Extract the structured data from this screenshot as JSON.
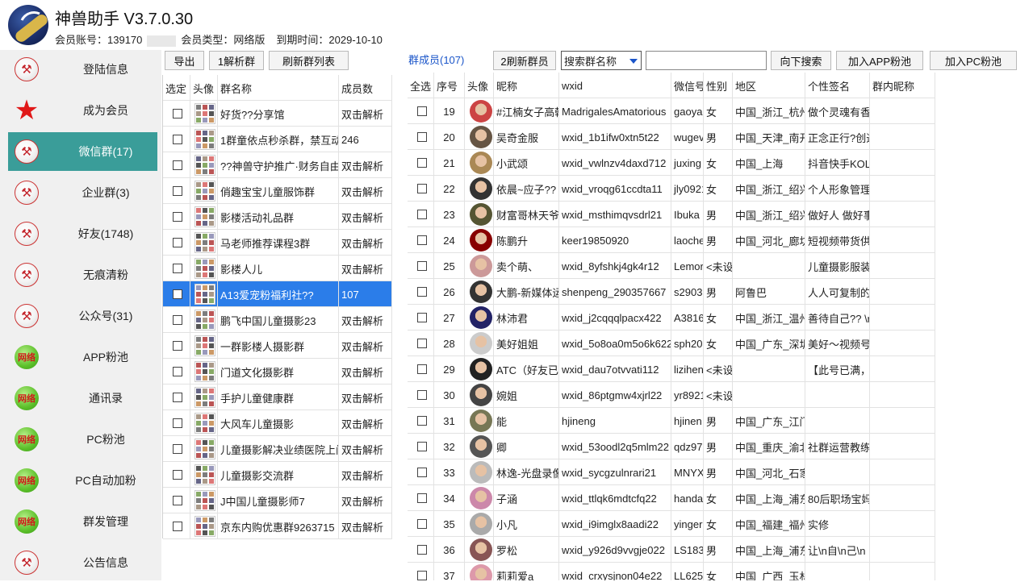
{
  "app": {
    "title": "神兽助手 V3.7.0.30",
    "account_label": "会员账号：139170",
    "member_type": "会员类型：网络版",
    "expire": "到期时间：2029-10-10"
  },
  "sidebar": {
    "items": [
      {
        "label": "登陆信息",
        "icon": "hammer-icon"
      },
      {
        "label": "成为会员",
        "icon": "star-icon"
      },
      {
        "label": "微信群(17)",
        "icon": "hammer-icon",
        "active": true
      },
      {
        "label": "企业群(3)",
        "icon": "hammer-icon"
      },
      {
        "label": "好友(1748)",
        "icon": "hammer-icon"
      },
      {
        "label": "无痕清粉",
        "icon": "hammer-icon"
      },
      {
        "label": "公众号(31)",
        "icon": "hammer-icon"
      },
      {
        "label": "APP粉池",
        "icon": "network-badge-icon"
      },
      {
        "label": "通讯录",
        "icon": "network-badge-icon"
      },
      {
        "label": "PC粉池",
        "icon": "network-badge-icon"
      },
      {
        "label": "PC自动加粉",
        "icon": "network-badge-icon"
      },
      {
        "label": "群发管理",
        "icon": "network-badge-icon"
      },
      {
        "label": "公告信息",
        "icon": "hammer-icon"
      }
    ],
    "badge_text": "网络"
  },
  "group_toolbar": {
    "export": "导出",
    "parse_one": "1解析群",
    "refresh_list": "刷新群列表"
  },
  "group_table": {
    "headers": [
      "选定",
      "头像",
      "群名称",
      "成员数"
    ],
    "rows": [
      {
        "name": "好货??分享馆",
        "count": "双击解析"
      },
      {
        "name": "1群童依点秒杀群，禁互动",
        "count": "246"
      },
      {
        "name": "??神兽守护推广·财务自由群",
        "count": "双击解析"
      },
      {
        "name": "俏趣宝宝儿童服饰群",
        "count": "双击解析"
      },
      {
        "name": "影楼活动礼品群",
        "count": "双击解析"
      },
      {
        "name": "马老师推荐课程3群",
        "count": "双击解析"
      },
      {
        "name": "影楼人儿",
        "count": "双击解析"
      },
      {
        "name": "A13爱宠粉福利社??",
        "count": "107",
        "selected": true
      },
      {
        "name": "鹏飞中国儿童摄影23",
        "count": "双击解析"
      },
      {
        "name": "一群影楼人摄影群",
        "count": "双击解析"
      },
      {
        "name": "门道文化摄影群",
        "count": "双击解析"
      },
      {
        "name": "手护儿童健康群",
        "count": "双击解析"
      },
      {
        "name": "大风车儿童摄影",
        "count": "双击解析"
      },
      {
        "name": "儿童摄影解决业绩医院上门",
        "count": "双击解析"
      },
      {
        "name": "儿童摄影交流群",
        "count": "双击解析"
      },
      {
        "name": "J中国儿童摄影师7",
        "count": "双击解析"
      },
      {
        "name": "京东内购优惠群9263715",
        "count": "双击解析"
      }
    ]
  },
  "member_toolbar": {
    "label": "群成员(107)",
    "refresh_members": "2刷新群员",
    "search_select": "搜索群名称",
    "search_down": "向下搜索",
    "add_app": "加入APP粉池",
    "add_pc": "加入PC粉池"
  },
  "member_table": {
    "headers": [
      "全选",
      "序号",
      "头像",
      "昵称",
      "wxid",
      "微信号",
      "性别",
      "地区",
      "个性签名",
      "群内昵称"
    ],
    "rows": [
      {
        "no": "19",
        "nick": "#江楠女子高韩",
        "wxid": "MadrigalesAmatorious",
        "wx": "gaoya",
        "sex": "女",
        "region": "中国_浙江_杭州",
        "sign": "做个灵魂有香"
      },
      {
        "no": "20",
        "nick": "吴奇金服",
        "wxid": "wxid_1b1ifw0xtn5t22",
        "wx": "wugev",
        "sex": "男",
        "region": "中国_天津_南开",
        "sign": "正念正行?创造"
      },
      {
        "no": "21",
        "nick": "小武颂",
        "wxid": "wxid_vwlnzv4daxd712",
        "wx": "juxing",
        "sex": "女",
        "region": "中国_上海",
        "sign": "抖音快手KOL"
      },
      {
        "no": "22",
        "nick": "依晨~应子??",
        "wxid": "wxid_vroqg61ccdta11",
        "wx": "jly0921",
        "sex": "女",
        "region": "中国_浙江_绍兴",
        "sign": "个人形象管理"
      },
      {
        "no": "23",
        "nick": "财富哥林天爷",
        "wxid": "wxid_msthimqvsdrl21",
        "wx": "Ibuka",
        "sex": "男",
        "region": "中国_浙江_绍兴",
        "sign": "做好人 做好事"
      },
      {
        "no": "24",
        "nick": "陈鹏升",
        "wxid": "keer19850920",
        "wx": "laoche",
        "sex": "男",
        "region": "中国_河北_廊坊",
        "sign": "短视频带货供"
      },
      {
        "no": "25",
        "nick": "卖个萌、",
        "wxid": "wxid_8yfshkj4gk4r12",
        "wx": "Lemor",
        "sex": "<未设",
        "region": "",
        "sign": "儿童摄影服装"
      },
      {
        "no": "26",
        "nick": "大鹏-新媒体运",
        "wxid": "shenpeng_290357667",
        "wx": "s2903",
        "sex": "男",
        "region": "阿鲁巴",
        "sign": "人人可复制的"
      },
      {
        "no": "27",
        "nick": "林沛君",
        "wxid": "wxid_j2cqqqlpacx422",
        "wx": "A3816",
        "sex": "女",
        "region": "中国_浙江_温州",
        "sign": "善待自己?? \\r"
      },
      {
        "no": "28",
        "nick": "美好姐姐",
        "wxid": "wxid_5o8oa0m5o6k622",
        "wx": "sph20",
        "sex": "女",
        "region": "中国_广东_深圳",
        "sign": "美好～视频号"
      },
      {
        "no": "29",
        "nick": "ATC（好友已满",
        "wxid": "wxid_dau7otvvati112",
        "wx": "lizihen",
        "sex": "<未设",
        "region": "",
        "sign": "【此号已满，"
      },
      {
        "no": "30",
        "nick": "婉姐",
        "wxid": "wxid_86ptgmw4xjrl22",
        "wx": "yr8921",
        "sex": "<未设",
        "region": "",
        "sign": ""
      },
      {
        "no": "31",
        "nick": "能",
        "wxid": "hjineng",
        "wx": "hjinen",
        "sex": "男",
        "region": "中国_广东_江门",
        "sign": ""
      },
      {
        "no": "32",
        "nick": "卿",
        "wxid": "wxid_53oodl2q5mlm22",
        "wx": "qdz97",
        "sex": "男",
        "region": "中国_重庆_渝北",
        "sign": "社群运营教练"
      },
      {
        "no": "33",
        "nick": "林逸-光盘录像",
        "wxid": "wxid_sycgzulnrari21",
        "wx": "MNYX",
        "sex": "男",
        "region": "中国_河北_石家",
        "sign": ""
      },
      {
        "no": "34",
        "nick": "子涵",
        "wxid": "wxid_ttlqk6mdtcfq22",
        "wx": "handa",
        "sex": "女",
        "region": "中国_上海_浦东",
        "sign": "80后职场宝妈"
      },
      {
        "no": "35",
        "nick": "小凡",
        "wxid": "wxid_i9imglx8aadi22",
        "wx": "yinger",
        "sex": "女",
        "region": "中国_福建_福州",
        "sign": "实修"
      },
      {
        "no": "36",
        "nick": "罗松",
        "wxid": "wxid_y926d9vvgje022",
        "wx": "LS183",
        "sex": "男",
        "region": "中国_上海_浦东",
        "sign": "让\\n自\\n己\\n"
      },
      {
        "no": "37",
        "nick": "莉莉爱a",
        "wxid": "wxid_crxysjnon04e22",
        "wx": "LL625",
        "sex": "女",
        "region": "中国_广西_玉林",
        "sign": ""
      }
    ]
  }
}
